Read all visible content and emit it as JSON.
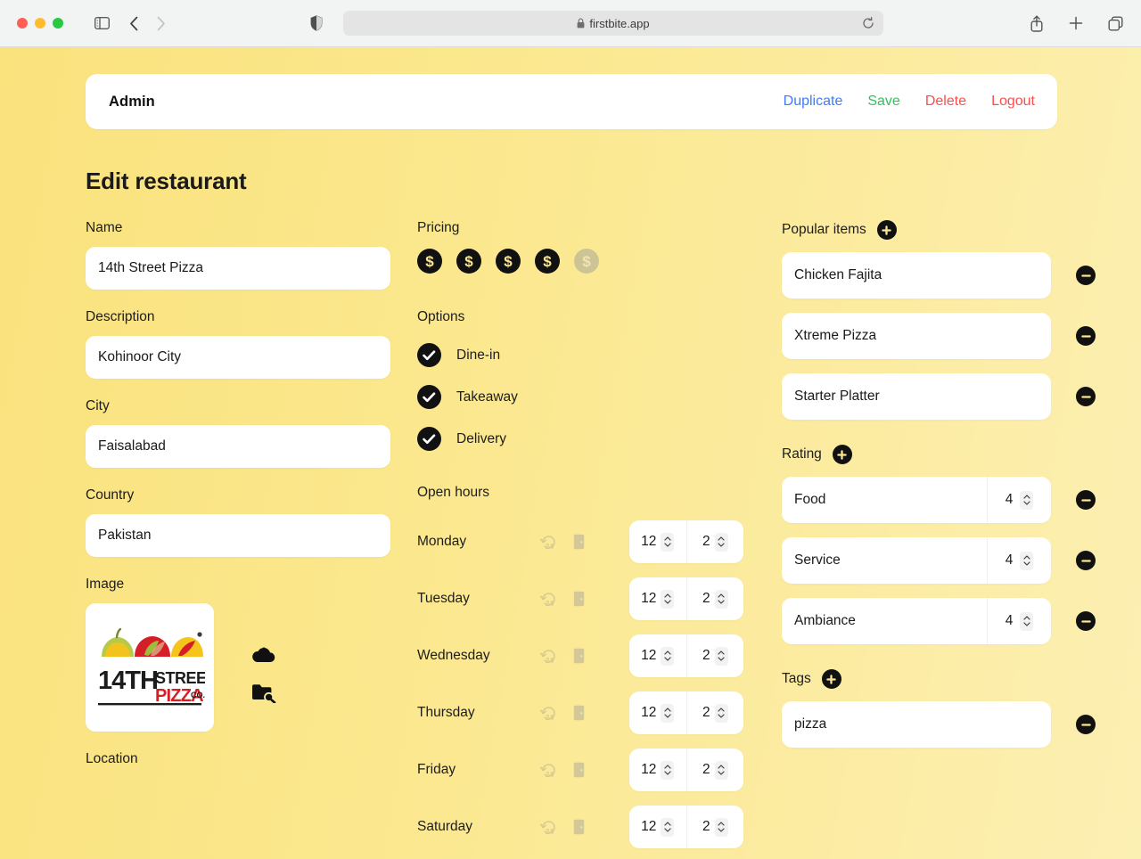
{
  "browser": {
    "url": "firstbite.app",
    "lock_icon": "lock-icon",
    "shield_icon": "shield-icon",
    "sidebar_icon": "sidebar-toggle-icon",
    "back_icon": "chevron-left-icon",
    "forward_icon": "chevron-right-icon",
    "reload_icon": "reload-icon",
    "share_icon": "share-icon",
    "newtab_icon": "plus-icon",
    "tabs_icon": "tab-overview-icon"
  },
  "admin_bar": {
    "title": "Admin",
    "actions": [
      {
        "label": "Duplicate",
        "color": "#3d7dfb"
      },
      {
        "label": "Save",
        "color": "#31c25d"
      },
      {
        "label": "Delete",
        "color": "#fb4e4e"
      },
      {
        "label": "Logout",
        "color": "#fb4e4e"
      }
    ]
  },
  "page": {
    "heading": "Edit restaurant"
  },
  "form": {
    "name": {
      "label": "Name",
      "value": "14th Street Pizza"
    },
    "description": {
      "label": "Description",
      "value": "Kohinoor City"
    },
    "city": {
      "label": "City",
      "value": "Faisalabad"
    },
    "country": {
      "label": "Country",
      "value": "Pakistan"
    },
    "image": {
      "label": "Image",
      "logo_alt": "14th Street Pizza Co.",
      "logo_line1": "14TH",
      "logo_line2": "STREET",
      "logo_line3": "PIZZA",
      "logo_line4": "CO.",
      "upload_icon": "cloud-upload-icon",
      "browse_icon": "folder-search-icon"
    },
    "location": {
      "label": "Location"
    }
  },
  "pricing": {
    "label": "Pricing",
    "symbol": "$",
    "total": 5,
    "selected": 4
  },
  "options": {
    "label": "Options",
    "items": [
      {
        "label": "Dine-in",
        "checked": true
      },
      {
        "label": "Takeaway",
        "checked": true
      },
      {
        "label": "Delivery",
        "checked": true
      }
    ]
  },
  "open_hours": {
    "label": "Open hours",
    "icons": {
      "all_day": "rotate-24h-icon",
      "closed": "door-icon"
    },
    "days": [
      {
        "day": "Monday",
        "open": "12",
        "close": "2"
      },
      {
        "day": "Tuesday",
        "open": "12",
        "close": "2"
      },
      {
        "day": "Wednesday",
        "open": "12",
        "close": "2"
      },
      {
        "day": "Thursday",
        "open": "12",
        "close": "2"
      },
      {
        "day": "Friday",
        "open": "12",
        "close": "2"
      },
      {
        "day": "Saturday",
        "open": "12",
        "close": "2"
      }
    ]
  },
  "popular_items": {
    "label": "Popular items",
    "add_icon": "plus-icon",
    "remove_icon": "minus-icon",
    "items": [
      {
        "value": "Chicken Fajita"
      },
      {
        "value": "Xtreme Pizza"
      },
      {
        "value": "Starter Platter"
      }
    ]
  },
  "rating": {
    "label": "Rating",
    "add_icon": "plus-icon",
    "remove_icon": "minus-icon",
    "items": [
      {
        "name": "Food",
        "value": "4"
      },
      {
        "name": "Service",
        "value": "4"
      },
      {
        "name": "Ambiance",
        "value": "4"
      }
    ]
  },
  "tags": {
    "label": "Tags",
    "add_icon": "plus-icon",
    "remove_icon": "minus-icon",
    "items": [
      {
        "value": "pizza"
      }
    ]
  },
  "colors": {
    "bg_start": "#fae27d",
    "bg_end": "#fcefb2",
    "card": "#ffffff",
    "accent_dark": "#111111",
    "dollar_glyph": "#fbe691",
    "dollar_off": "#cdc496"
  }
}
